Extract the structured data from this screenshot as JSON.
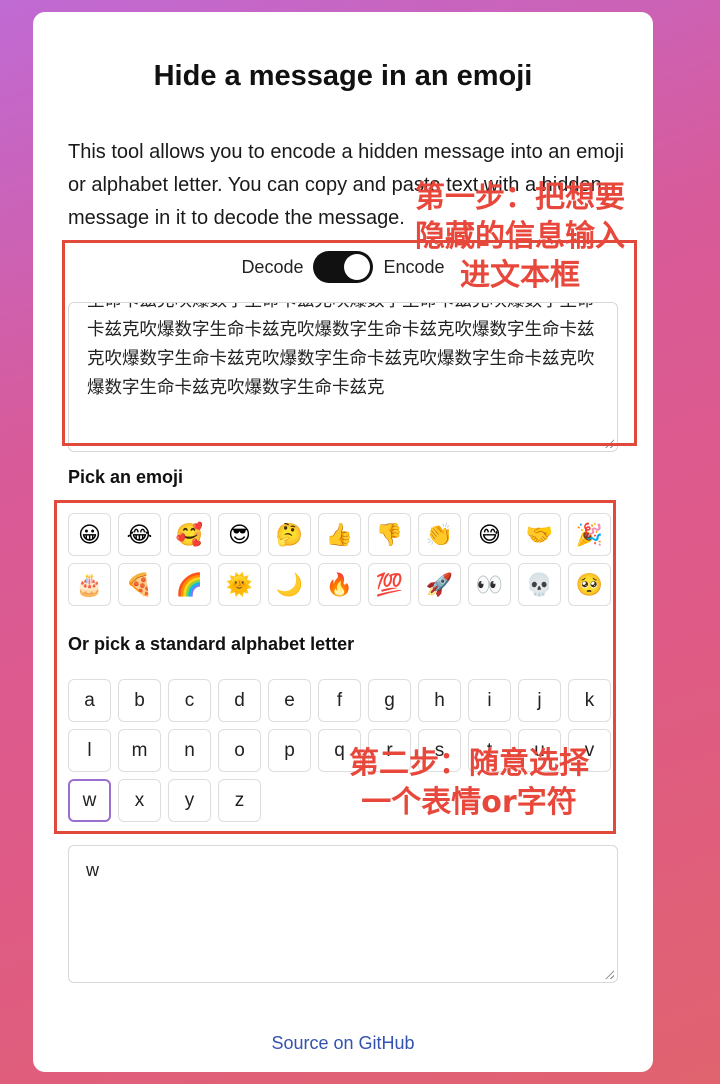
{
  "page": {
    "title": "Hide a message in an emoji",
    "intro": "This tool allows you to encode a hidden message into an emoji or alphabet letter. You can copy and paste text with a hidden message in it to decode the message."
  },
  "mode": {
    "decode_label": "Decode",
    "encode_label": "Encode",
    "current": "Encode"
  },
  "message_input": {
    "value": "生命卡兹克吹爆数字生命卡兹克吹爆数字生命卡兹克吹爆数字生命卡兹克吹爆数字生命卡兹克吹爆数字生命卡兹克吹爆数字生命卡兹克吹爆数字生命卡兹克吹爆数字生命卡兹克吹爆数字生命卡兹克吹爆数字生命卡兹克吹爆数字生命卡兹克"
  },
  "emoji_section": {
    "label": "Pick an emoji",
    "items": [
      "😀",
      "😂",
      "🥰",
      "😎",
      "🤔",
      "👍",
      "👎",
      "👏",
      "😅",
      "🤝",
      "🎉",
      "🎂",
      "🍕",
      "🌈",
      "🌞",
      "🌙",
      "🔥",
      "💯",
      "🚀",
      "👀",
      "💀",
      "🥺"
    ]
  },
  "letter_section": {
    "label": "Or pick a standard alphabet letter",
    "items": [
      "a",
      "b",
      "c",
      "d",
      "e",
      "f",
      "g",
      "h",
      "i",
      "j",
      "k",
      "l",
      "m",
      "n",
      "o",
      "p",
      "q",
      "r",
      "s",
      "t",
      "u",
      "v",
      "w",
      "x",
      "y",
      "z"
    ],
    "selected": "w"
  },
  "output": {
    "value": "w"
  },
  "footer": {
    "link_label": "Source on GitHub"
  },
  "annotations": {
    "step1": [
      "第一步：把想要",
      "隐藏的信息输入",
      "进文本框"
    ],
    "step2": [
      "第二步：随意选择",
      "一个表情or字符"
    ],
    "color": "#e14a3a"
  }
}
